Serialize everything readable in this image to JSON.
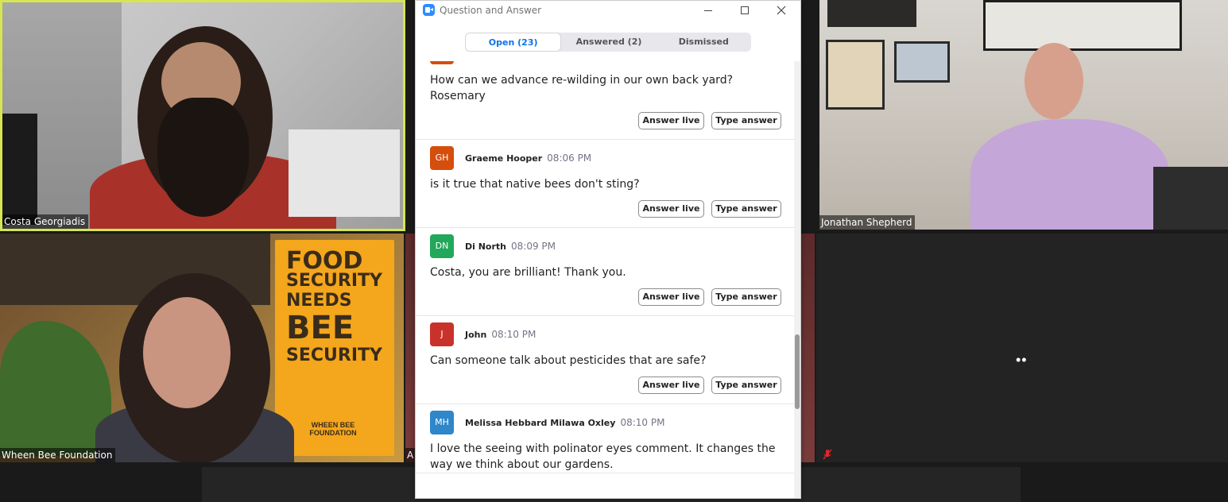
{
  "participants": [
    {
      "id": "costa",
      "name": "Costa Georgiadis"
    },
    {
      "id": "jonathan",
      "name": "Jonathan Shepherd"
    },
    {
      "id": "wheen",
      "name": "Wheen Bee Foundation"
    },
    {
      "id": "mid",
      "name": "A"
    }
  ],
  "banner": {
    "line1": "FOOD",
    "line2": "SECURITY",
    "line3": "NEEDS",
    "line4": "BEE",
    "line5": "SECURITY",
    "logo": "WHEEN BEE FOUNDATION"
  },
  "blank_tile": {
    "indicator": "••"
  },
  "qa": {
    "title": "Question and Answer",
    "tabs": [
      {
        "label": "Open (23)",
        "active": true
      },
      {
        "label": "Answered (2)",
        "active": false
      },
      {
        "label": "Dismissed",
        "active": false
      }
    ],
    "buttons": {
      "answer_live": "Answer live",
      "type_answer": "Type answer"
    },
    "questions": [
      {
        "initials": "",
        "name": "",
        "time": "",
        "color": "#d44e0c",
        "text": "How can we advance re-wilding in our own back yard? Rosemary"
      },
      {
        "initials": "GH",
        "name": "Graeme Hooper",
        "time": "08:06 PM",
        "color": "#d44e0c",
        "text": "is it true that native bees don't sting?"
      },
      {
        "initials": "DN",
        "name": "Di North",
        "time": "08:09 PM",
        "color": "#23a75a",
        "text": "Costa, you are brilliant! Thank you."
      },
      {
        "initials": "J",
        "name": "John",
        "time": "08:10 PM",
        "color": "#c9322b",
        "text": "Can someone talk about pesticides that are safe?"
      },
      {
        "initials": "MH",
        "name": "Melissa Hebbard Milawa Oxley",
        "time": "08:10 PM",
        "color": "#2f86c8",
        "text": "I love the seeing with polinator eyes comment. It changes the way we think about our gardens."
      }
    ]
  }
}
